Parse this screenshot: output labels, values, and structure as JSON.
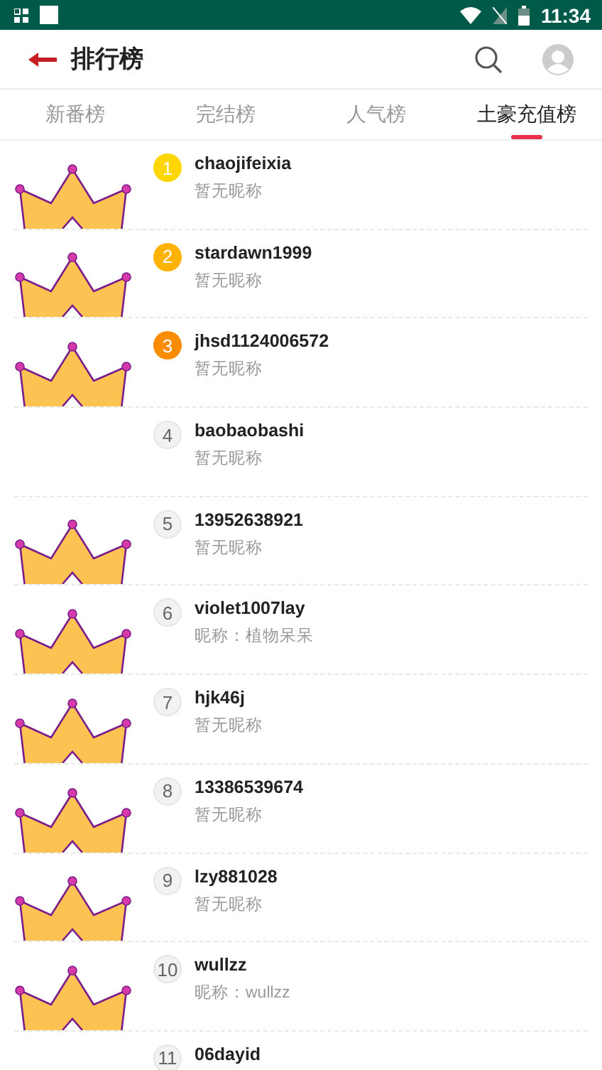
{
  "status_bar": {
    "time": "11:34"
  },
  "app_bar": {
    "title": "排行榜"
  },
  "tabs": [
    {
      "label": "新番榜",
      "selected": false
    },
    {
      "label": "完结榜",
      "selected": false
    },
    {
      "label": "人气榜",
      "selected": false
    },
    {
      "label": "土豪充值榜",
      "selected": true
    }
  ],
  "ranking": [
    {
      "rank": "1",
      "color": "#ffd600",
      "crown": true,
      "name": "chaojifeixia",
      "nickname": "暂无昵称"
    },
    {
      "rank": "2",
      "color": "#ffb300",
      "crown": true,
      "name": "stardawn1999",
      "nickname": "暂无昵称"
    },
    {
      "rank": "3",
      "color": "#fb8c00",
      "crown": true,
      "name": "jhsd1124006572",
      "nickname": "暂无昵称"
    },
    {
      "rank": "4",
      "crown": false,
      "name": "baobaobashi",
      "nickname": "暂无昵称"
    },
    {
      "rank": "5",
      "crown": true,
      "name": "13952638921",
      "nickname": "暂无昵称"
    },
    {
      "rank": "6",
      "crown": true,
      "name": "violet1007lay",
      "nickname": "昵称：植物呆呆"
    },
    {
      "rank": "7",
      "crown": true,
      "name": "hjk46j",
      "nickname": "暂无昵称"
    },
    {
      "rank": "8",
      "crown": true,
      "name": "13386539674",
      "nickname": "暂无昵称"
    },
    {
      "rank": "9",
      "crown": true,
      "name": "lzy881028",
      "nickname": "暂无昵称"
    },
    {
      "rank": "10",
      "crown": true,
      "name": "wullzz",
      "nickname": "昵称：wullzz"
    },
    {
      "rank": "11",
      "crown": false,
      "name": "06dayid"
    }
  ]
}
